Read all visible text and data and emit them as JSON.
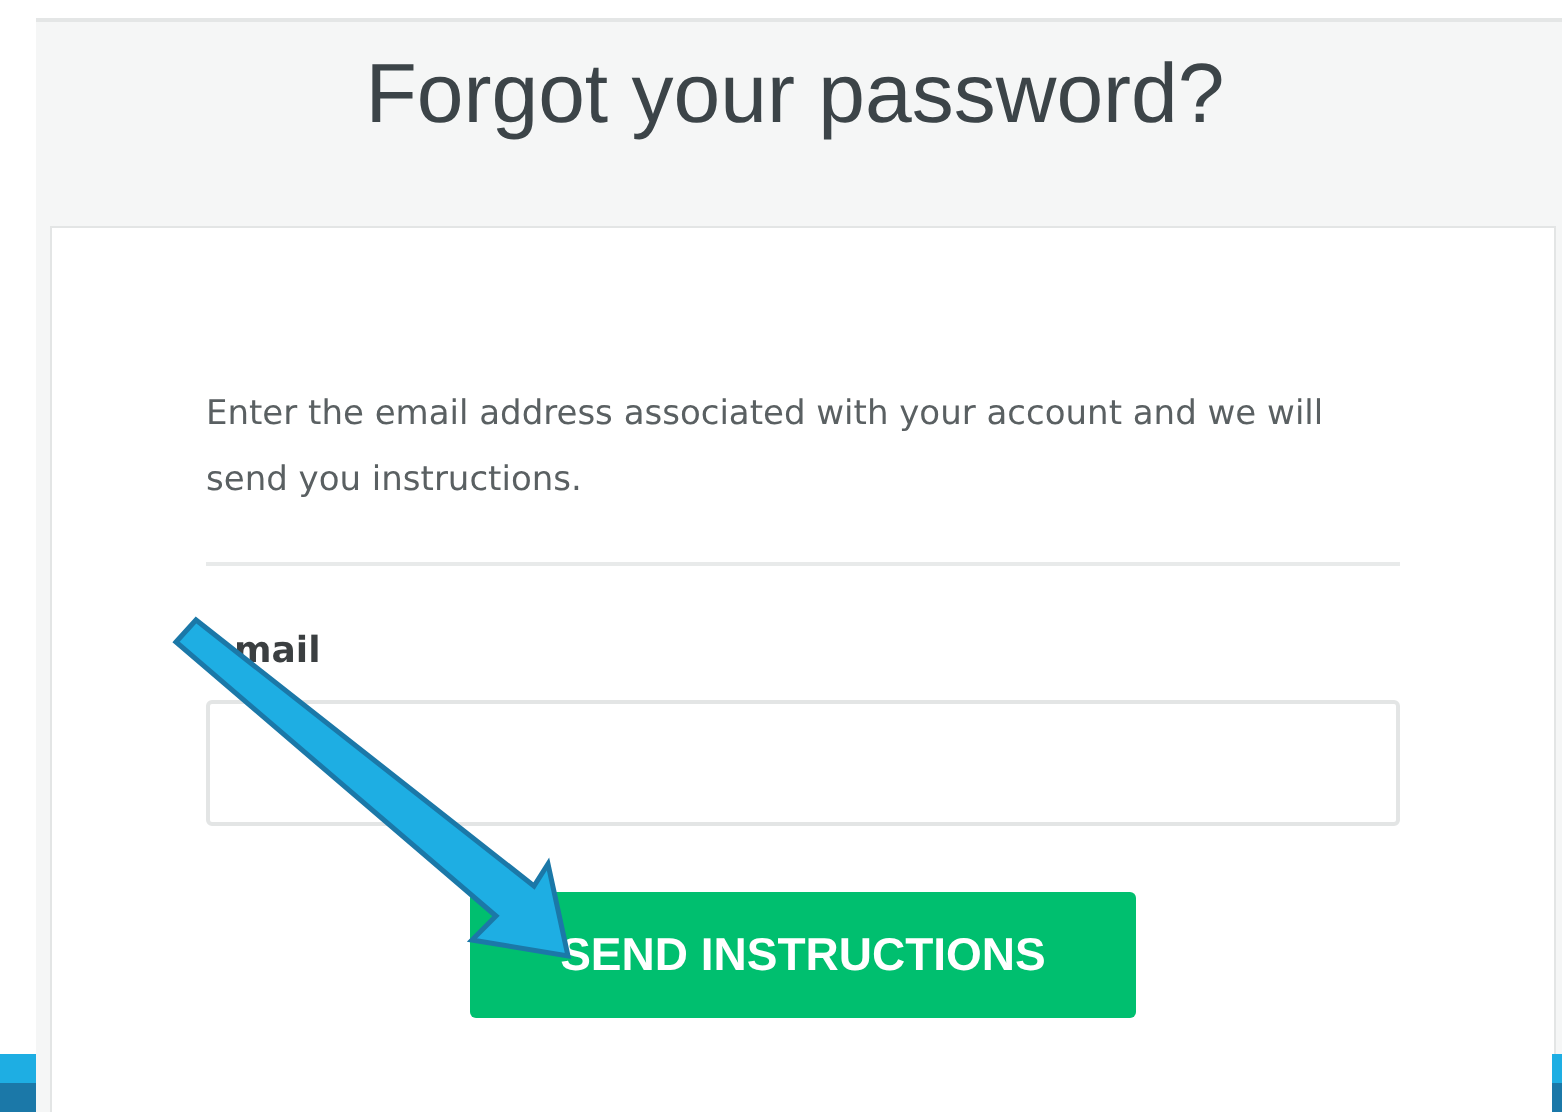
{
  "title": "Forgot your password?",
  "instructions": "Enter the email address associated with your account and we will send you instructions.",
  "email_field": {
    "label": "mail"
  },
  "button": "SEND INSTRUCTIONS"
}
